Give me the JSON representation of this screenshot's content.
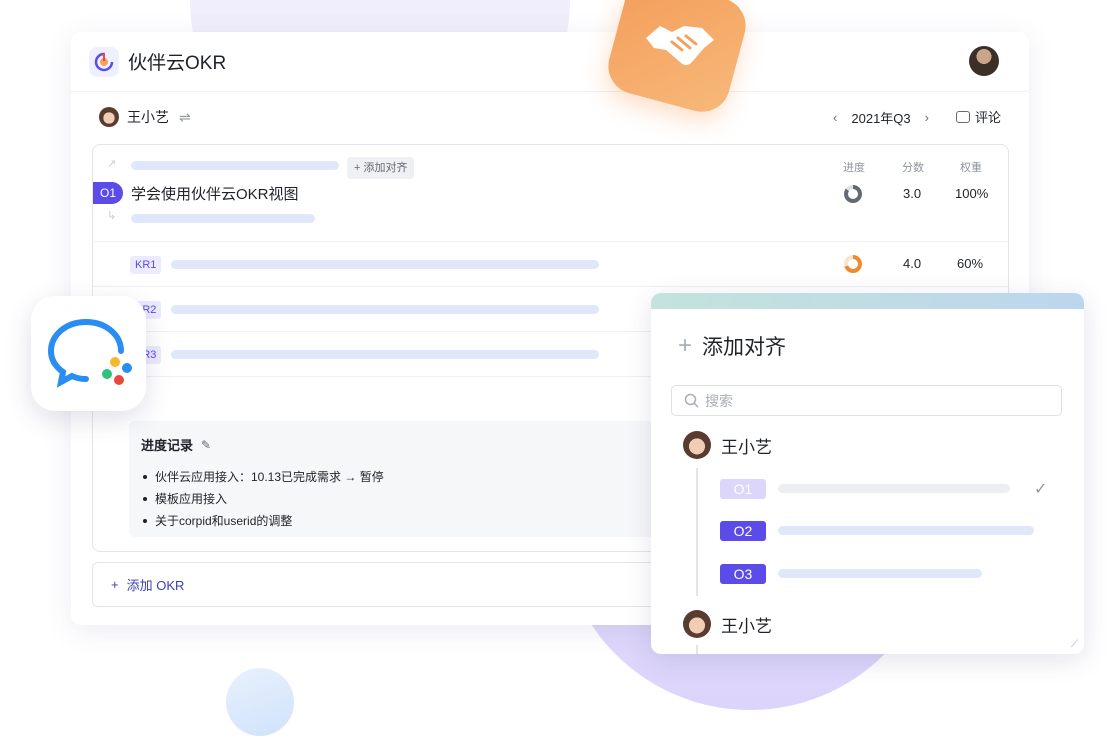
{
  "app": {
    "title": "伙伴云OKR"
  },
  "subbar": {
    "user_name": "王小艺",
    "period": "2021年Q3",
    "prev": "‹",
    "next": "›",
    "comment_label": "评论"
  },
  "columns": {
    "progress": "进度",
    "score": "分数",
    "weight": "权重"
  },
  "objective": {
    "tag": "O1",
    "title": "学会使用伙伴云OKR视图",
    "add_align_label": "+ 添加对齐",
    "progress": 0.85,
    "score": "3.0",
    "weight": "100%"
  },
  "key_results": [
    {
      "tag": "KR1",
      "progress": 0.7,
      "score": "4.0",
      "weight": "60%"
    },
    {
      "tag": "KR2"
    },
    {
      "tag": "KR3"
    }
  ],
  "progress_log": {
    "title": "进度记录",
    "items": [
      "伙伴云应用接入：10.13已完成需求 → 暂停",
      "模板应用接入",
      "关于corpid和userid的调整"
    ]
  },
  "add_okr_label": "添加 OKR",
  "align_panel": {
    "title": "添加对齐",
    "search_placeholder": "搜索",
    "users": [
      {
        "name": "王小艺",
        "objectives": [
          {
            "tag": "O1",
            "selected": true
          },
          {
            "tag": "O2"
          },
          {
            "tag": "O3"
          }
        ]
      },
      {
        "name": "王小艺"
      }
    ]
  },
  "colors": {
    "accent": "#5b4be8",
    "orange": "#f5a15e",
    "ring_gray": "#646a73",
    "ring_orange": "#f08a2c"
  },
  "icons": [
    "okr-logo-icon",
    "user-avatar-icon",
    "switch-icon",
    "chevron-left-icon",
    "chevron-right-icon",
    "comment-icon",
    "progress-ring-icon",
    "edit-icon",
    "plus-icon",
    "search-icon",
    "check-icon",
    "wecom-app-icon",
    "handshake-icon",
    "resize-handle-icon"
  ]
}
